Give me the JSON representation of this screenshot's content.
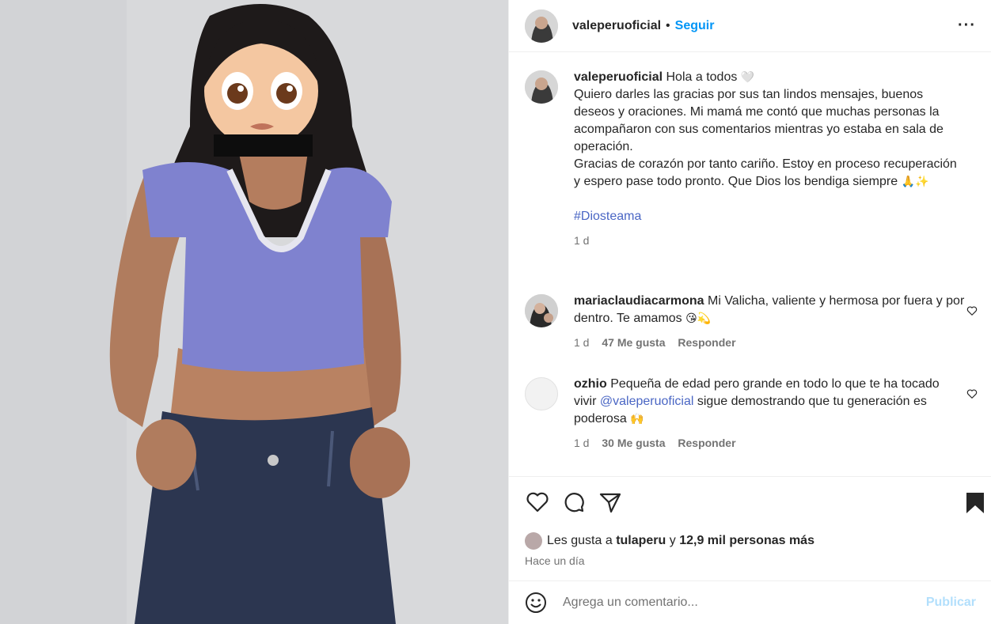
{
  "post": {
    "username": "valeperuoficial",
    "separator": "•",
    "follow_label": "Seguir",
    "more_label": "···"
  },
  "caption": {
    "username": "valeperuoficial",
    "text": "Hola a todos",
    "emoji": "🤍",
    "body": "Quiero darles las gracias por sus tan lindos mensajes, buenos deseos y oraciones. Mi mamá me contó que muchas personas la acompañaron con sus comentarios mientras yo estaba en sala de operación.\nGracias de corazón por tanto cariño. Estoy en proceso recuperación y espero pase todo pronto. Que Dios los bendiga siempre",
    "body_emoji": "🙏✨",
    "hashtag": "#Diosteama",
    "time": "1 d"
  },
  "comments": [
    {
      "username": "mariaclaudiacarmona",
      "text": "Mi Valicha, valiente y hermosa por fuera y por dentro. Te amamos",
      "emoji": "😘💫",
      "time": "1 d",
      "likes": "47 Me gusta",
      "reply": "Responder"
    },
    {
      "username": "ozhio",
      "text_before": "Pequeña de edad pero grande en todo lo que te ha tocado vivir",
      "mention": "@valeperuoficial",
      "text_after": "sigue demostrando que tu generación es poderosa",
      "emoji": "🙌",
      "time": "1 d",
      "likes": "30 Me gusta",
      "reply": "Responder"
    }
  ],
  "likes_line": {
    "prefix": "Les gusta a",
    "user": "tulaperu",
    "middle": "y",
    "rest": "12,9 mil personas más"
  },
  "posted_ago": "Hace un día",
  "add_comment": {
    "placeholder": "Agrega un comentario...",
    "publish_label": "Publicar"
  },
  "icons": {
    "like": "heart-icon",
    "comment": "comment-icon",
    "share": "share-icon",
    "save": "bookmark-icon",
    "emoji": "emoji-icon"
  },
  "colors": {
    "link": "#0095f6",
    "mention": "#4a66c4",
    "muted": "#737373",
    "publish_disabled": "#b2dffc",
    "top_color": "#7f82cf",
    "skirt_color": "#2c3650"
  }
}
